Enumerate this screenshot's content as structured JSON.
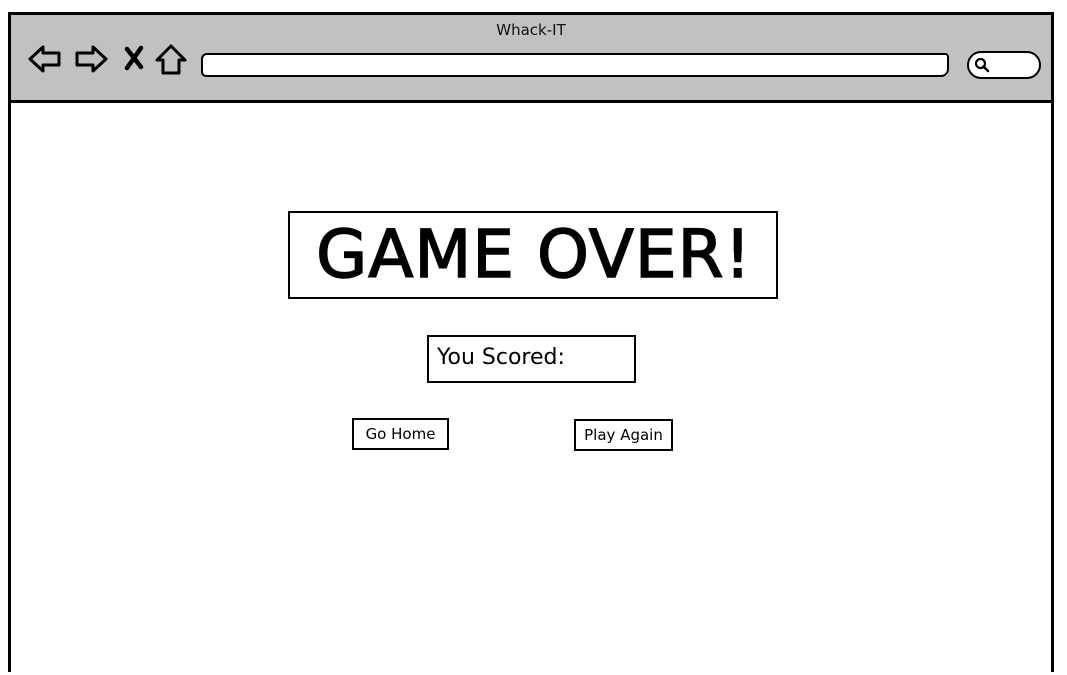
{
  "window": {
    "title": "Whack-IT"
  },
  "toolbar": {
    "icons": [
      "back-arrow-icon",
      "forward-arrow-icon",
      "stop-icon",
      "home-icon"
    ],
    "address_value": "",
    "search_icon": "search-icon"
  },
  "main": {
    "heading": "GAME OVER!",
    "score_label": "You Scored:",
    "go_home_label": "Go Home",
    "play_again_label": "Play Again"
  },
  "colors": {
    "chrome_bg": "#c1c1c1",
    "border": "#000000",
    "page_bg": "#ffffff"
  }
}
